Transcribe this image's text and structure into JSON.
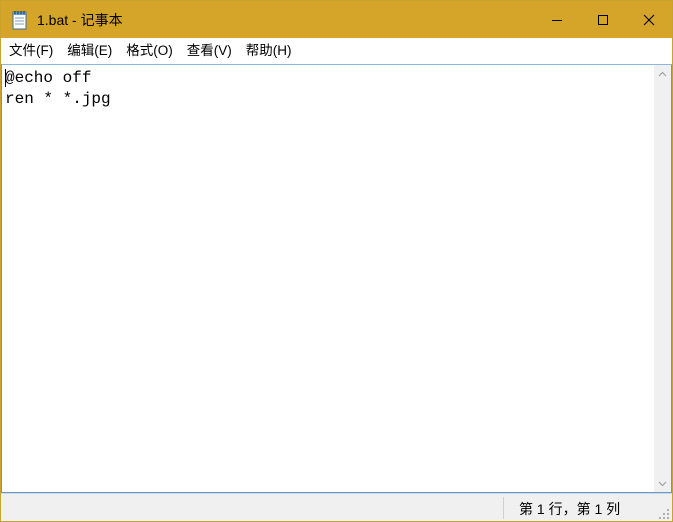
{
  "window": {
    "title": "1.bat - 记事本",
    "icon": "notepad-icon",
    "accent_color": "#d4a528"
  },
  "caption_buttons": {
    "minimize": "minimize-icon",
    "maximize": "maximize-icon",
    "close": "close-icon"
  },
  "menu": {
    "items": [
      {
        "label": "文件(F)"
      },
      {
        "label": "编辑(E)"
      },
      {
        "label": "格式(O)"
      },
      {
        "label": "查看(V)"
      },
      {
        "label": "帮助(H)"
      }
    ]
  },
  "editor": {
    "lines": [
      "@echo off",
      "ren * *.jpg"
    ]
  },
  "status": {
    "position": "第 1 行，第 1 列"
  }
}
